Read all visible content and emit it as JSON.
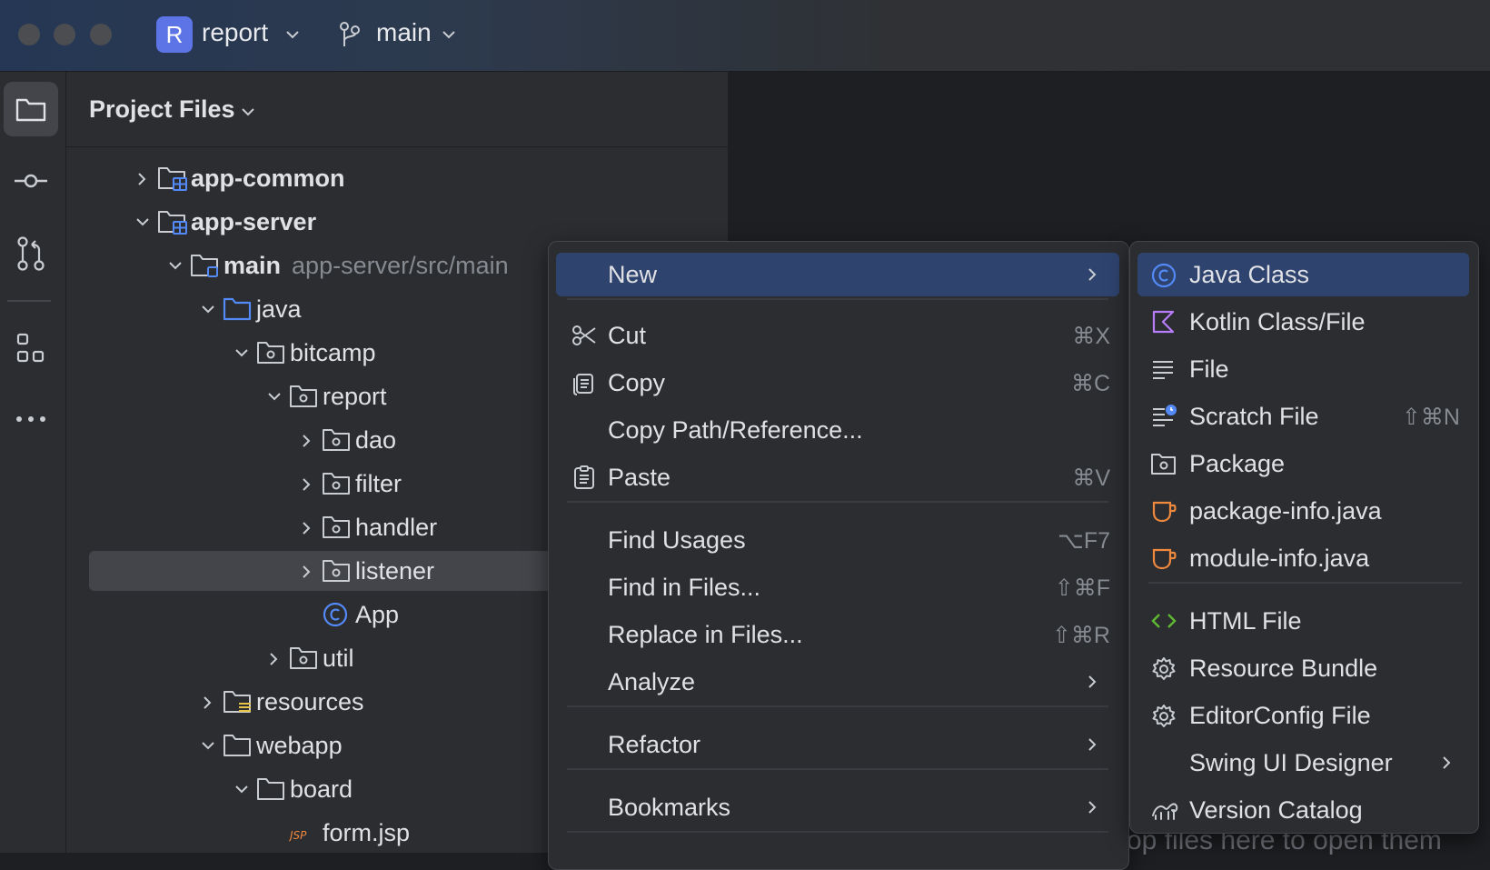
{
  "titlebar": {
    "project_initial": "R",
    "project_name": "report",
    "branch": "main"
  },
  "panel": {
    "title": "Project Files"
  },
  "tree": [
    {
      "label": "app-common",
      "hint": "",
      "bold": true
    },
    {
      "label": "app-server",
      "hint": "",
      "bold": true
    },
    {
      "label": "main",
      "hint": "app-server/src/main",
      "bold": true
    },
    {
      "label": "java",
      "hint": "",
      "bold": false
    },
    {
      "label": "bitcamp",
      "hint": "",
      "bold": false
    },
    {
      "label": "report",
      "hint": "",
      "bold": false
    },
    {
      "label": "dao",
      "hint": "",
      "bold": false
    },
    {
      "label": "filter",
      "hint": "",
      "bold": false
    },
    {
      "label": "handler",
      "hint": "",
      "bold": false
    },
    {
      "label": "listener",
      "hint": "",
      "bold": false,
      "selected": true
    },
    {
      "label": "App",
      "hint": "",
      "bold": false
    },
    {
      "label": "util",
      "hint": "",
      "bold": false
    },
    {
      "label": "resources",
      "hint": "",
      "bold": false
    },
    {
      "label": "webapp",
      "hint": "",
      "bold": false
    },
    {
      "label": "board",
      "hint": "",
      "bold": false
    },
    {
      "label": "form.jsp",
      "hint": "",
      "bold": false,
      "badge": "JSP"
    }
  ],
  "context_menu": [
    {
      "label": "New",
      "shortcut": "",
      "submenu": true,
      "highlighted": true
    },
    {
      "label": "Cut",
      "shortcut": "⌘X",
      "icon": "scissors-icon"
    },
    {
      "label": "Copy",
      "shortcut": "⌘C",
      "icon": "copy-icon"
    },
    {
      "label": "Copy Path/Reference...",
      "shortcut": ""
    },
    {
      "label": "Paste",
      "shortcut": "⌘V",
      "icon": "paste-icon"
    },
    {
      "label": "Find Usages",
      "shortcut": "⌥F7"
    },
    {
      "label": "Find in Files...",
      "shortcut": "⇧⌘F"
    },
    {
      "label": "Replace in Files...",
      "shortcut": "⇧⌘R"
    },
    {
      "label": "Analyze",
      "shortcut": "",
      "submenu": true
    },
    {
      "label": "Refactor",
      "shortcut": "",
      "submenu": true
    },
    {
      "label": "Bookmarks",
      "shortcut": "",
      "submenu": true
    }
  ],
  "new_submenu": [
    {
      "label": "Java Class",
      "shortcut": "",
      "icon": "java-class-icon",
      "highlighted": true
    },
    {
      "label": "Kotlin Class/File",
      "shortcut": "",
      "icon": "kotlin-icon"
    },
    {
      "label": "File",
      "shortcut": "",
      "icon": "file-lines-icon"
    },
    {
      "label": "Scratch File",
      "shortcut": "⇧⌘N",
      "icon": "scratch-file-icon"
    },
    {
      "label": "Package",
      "shortcut": "",
      "icon": "package-icon"
    },
    {
      "label": "package-info.java",
      "shortcut": "",
      "icon": "java-cup-icon"
    },
    {
      "label": "module-info.java",
      "shortcut": "",
      "icon": "java-cup-icon"
    },
    {
      "label": "HTML File",
      "shortcut": "",
      "icon": "html-icon"
    },
    {
      "label": "Resource Bundle",
      "shortcut": "",
      "icon": "gear-icon"
    },
    {
      "label": "EditorConfig File",
      "shortcut": "",
      "icon": "gear-icon"
    },
    {
      "label": "Swing UI Designer",
      "shortcut": "",
      "submenu": true
    },
    {
      "label": "Version Catalog",
      "shortcut": "",
      "icon": "version-catalog-icon"
    }
  ],
  "editor": {
    "empty_hint": "op files here to open them"
  },
  "colors": {
    "highlight": "#2e436e",
    "menu_bg": "#2b2d30",
    "text": "#dfe1e5",
    "muted": "#868a91",
    "project_badge": "#5c74e6",
    "java_class": "#548af7",
    "kotlin": "#b87dfb",
    "java_cup": "#f0883e",
    "html": "#5fb832"
  }
}
